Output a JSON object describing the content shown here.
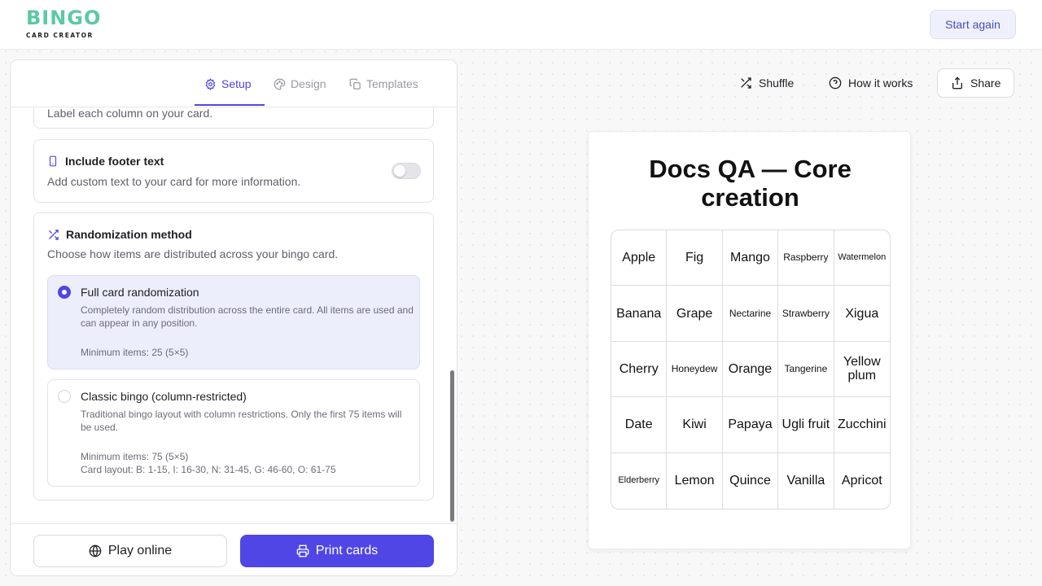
{
  "header": {
    "logo_main": "BINGO",
    "logo_sub": "CARD CREATOR",
    "start_again": "Start again"
  },
  "tabs": [
    {
      "label": "Setup",
      "icon": "gear-icon",
      "active": true
    },
    {
      "label": "Design",
      "icon": "palette-icon",
      "active": false
    },
    {
      "label": "Templates",
      "icon": "copy-icon",
      "active": false
    }
  ],
  "settings": {
    "column_labels": {
      "desc": "Label each column on your card."
    },
    "footer_text": {
      "title": "Include footer text",
      "desc": "Add custom text to your card for more information.",
      "enabled": false
    },
    "randomization": {
      "title": "Randomization method",
      "desc": "Choose how items are distributed across your bingo card.",
      "options": [
        {
          "title": "Full card randomization",
          "desc": "Completely random distribution across the entire card. All items are used and can appear in any position.",
          "min": "Minimum items: 25 (5×5)",
          "selected": true
        },
        {
          "title": "Classic bingo (column-restricted)",
          "desc": "Traditional bingo layout with column restrictions. Only the first 75 items will be used.",
          "min": "Minimum items: 75 (5×5)",
          "layout": "Card layout: B: 1-15, I: 16-30, N: 31-45, G: 46-60, O: 61-75",
          "selected": false
        }
      ]
    }
  },
  "footer": {
    "play_online": "Play online",
    "print_cards": "Print cards"
  },
  "toolbar": {
    "shuffle": "Shuffle",
    "how_it_works": "How it works",
    "share": "Share"
  },
  "card": {
    "title_line1": "Docs QA — Core",
    "title_line2": "creation",
    "cells": [
      "Apple",
      "Fig",
      "Mango",
      "Raspberry",
      "Watermelon",
      "Banana",
      "Grape",
      "Nectarine",
      "Strawberry",
      "Xigua",
      "Cherry",
      "Honeydew",
      "Orange",
      "Tangerine",
      "Yellow plum",
      "Date",
      "Kiwi",
      "Papaya",
      "Ugli fruit",
      "Zucchini",
      "Elderberry",
      "Lemon",
      "Quince",
      "Vanilla",
      "Apricot"
    ]
  },
  "colors": {
    "accent": "#4f46e5",
    "logo_green": "#5cc9a2",
    "selected_bg": "#eceefb"
  }
}
